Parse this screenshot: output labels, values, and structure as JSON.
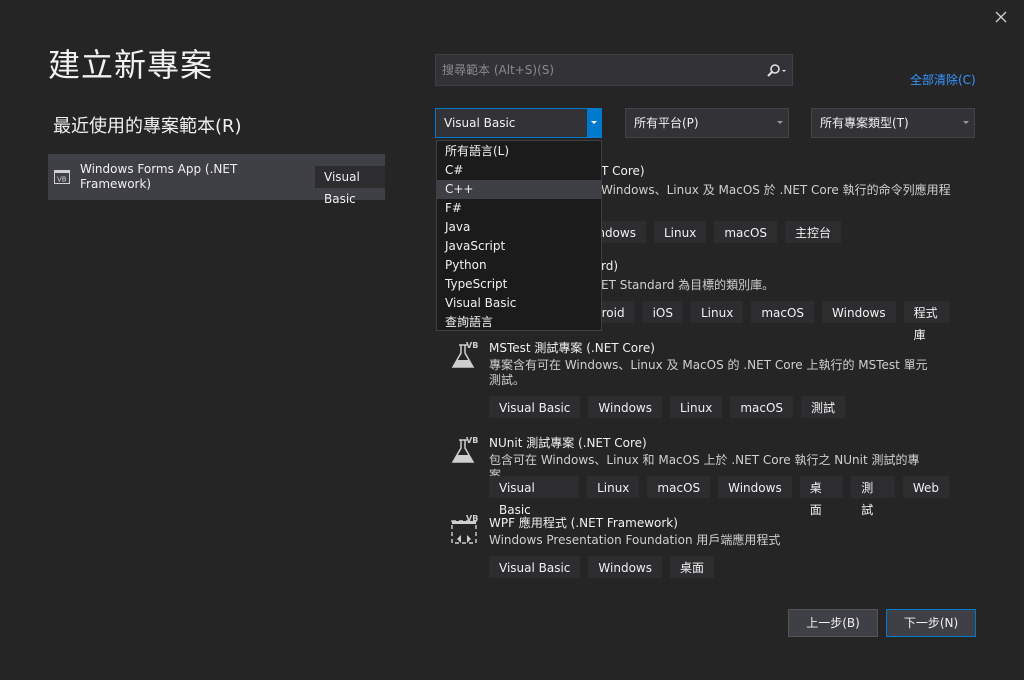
{
  "window": {
    "title": "建立新專案",
    "close_icon": "close-icon"
  },
  "recent": {
    "heading": "最近使用的專案範本(R)",
    "items": [
      {
        "name": "Windows Forms App (.NET Framework)",
        "language": "Visual Basic",
        "icon": "vb-winforms-icon"
      }
    ]
  },
  "search": {
    "placeholder": "搜尋範本 (Alt+S)(S)",
    "value": ""
  },
  "clear_all": "全部清除(C)",
  "filters": {
    "language": "Visual Basic",
    "platform": "所有平台(P)",
    "project_type": "所有專案類型(T)"
  },
  "language_options": [
    "所有語言(L)",
    "C#",
    "C++",
    "F#",
    "Java",
    "JavaScript",
    "Python",
    "TypeScript",
    "Visual Basic",
    "查詢語言"
  ],
  "highlighted_option": "C++",
  "templates": [
    {
      "name_partial": "T Core)",
      "desc_partial": "Windows、Linux 及 MacOS 於 .NET Core 執行的命令列應用程",
      "tags_partial": [
        "indows",
        "Linux",
        "macOS",
        "主控台"
      ]
    },
    {
      "name_partial": "rd)",
      "desc_partial": "ET Standard 為目標的類別庫。",
      "tags_partial": [
        "droid",
        "iOS",
        "Linux",
        "macOS",
        "Windows",
        "程式庫"
      ]
    },
    {
      "name": "MSTest 測試專案 (.NET Core)",
      "desc": "專案含有可在 Windows、Linux 及 MacOS 的 .NET Core 上執行的 MSTest 單元測試。",
      "tags": [
        "Visual Basic",
        "Windows",
        "Linux",
        "macOS",
        "測試"
      ]
    },
    {
      "name": "NUnit 測試專案 (.NET Core)",
      "desc": "包含可在 Windows、Linux 和 MacOS 上於 .NET Core 執行之 NUnit 測試的專案。",
      "tags": [
        "Visual Basic",
        "Linux",
        "macOS",
        "Windows",
        "桌面",
        "測試",
        "Web"
      ]
    },
    {
      "name": "WPF 應用程式 (.NET Framework)",
      "desc": "Windows Presentation Foundation 用戶端應用程式",
      "tags": [
        "Visual Basic",
        "Windows",
        "桌面"
      ]
    }
  ],
  "buttons": {
    "back": "上一步(B)",
    "next": "下一步(N)"
  },
  "colors": {
    "accent": "#007acc",
    "link": "#3794ff",
    "background": "#252526"
  }
}
